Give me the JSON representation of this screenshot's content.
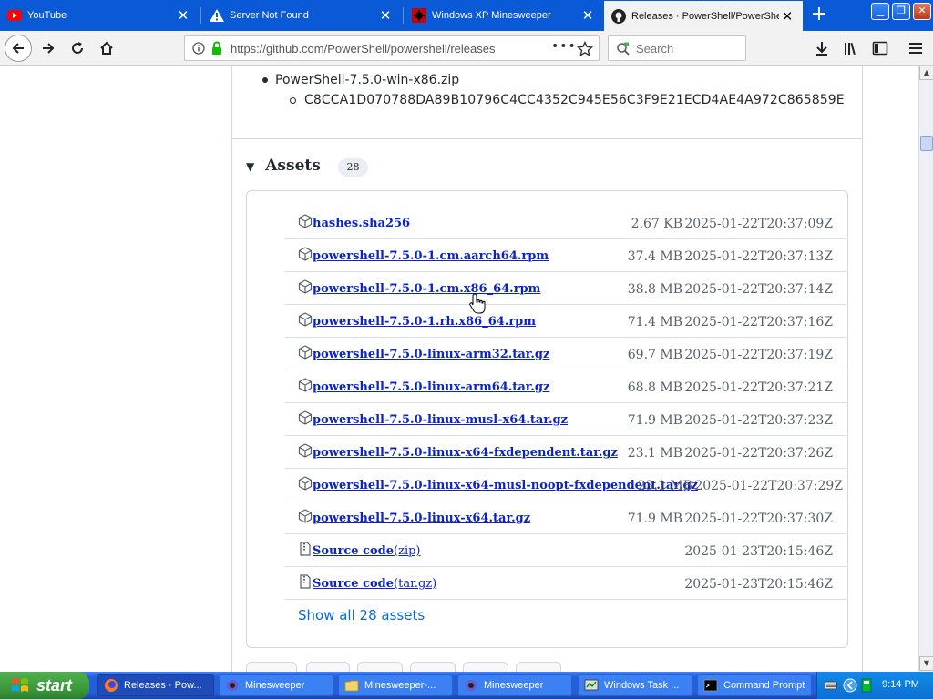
{
  "tabs": [
    {
      "label": "YouTube",
      "icon": "youtube-icon",
      "active": false
    },
    {
      "label": "Server Not Found",
      "icon": "warning-icon",
      "active": false
    },
    {
      "label": "Windows XP Minesweeper",
      "icon": "mine-icon",
      "active": false
    },
    {
      "label": "Releases · PowerShell/PowerShell",
      "icon": "github-icon",
      "active": true
    }
  ],
  "nav": {
    "url": "https://github.com/PowerShell/powershell/releases",
    "search_placeholder": "Search",
    "page_actions": "•••"
  },
  "page": {
    "bullet_file": "PowerShell-7.5.0-win-x86.zip",
    "bullet_hash": "C8CCA1D070788DA89B10796C4CC4352C945E56C3F9E21ECD4AE4A972C865859E",
    "assets_title": "Assets",
    "assets_count": "28",
    "show_all": "Show all 28 assets"
  },
  "assets": [
    {
      "name": "hashes.sha256",
      "size": "2.67 KB",
      "date": "2025-01-22T20:37:09Z",
      "kind": "package"
    },
    {
      "name": "powershell-7.5.0-1.cm.aarch64.rpm",
      "size": "37.4 MB",
      "date": "2025-01-22T20:37:13Z",
      "kind": "package"
    },
    {
      "name": "powershell-7.5.0-1.cm.x86_64.rpm",
      "size": "38.8 MB",
      "date": "2025-01-22T20:37:14Z",
      "kind": "package"
    },
    {
      "name": "powershell-7.5.0-1.rh.x86_64.rpm",
      "size": "71.4 MB",
      "date": "2025-01-22T20:37:16Z",
      "kind": "package"
    },
    {
      "name": "powershell-7.5.0-linux-arm32.tar.gz",
      "size": "69.7 MB",
      "date": "2025-01-22T20:37:19Z",
      "kind": "package"
    },
    {
      "name": "powershell-7.5.0-linux-arm64.tar.gz",
      "size": "68.8 MB",
      "date": "2025-01-22T20:37:21Z",
      "kind": "package"
    },
    {
      "name": "powershell-7.5.0-linux-musl-x64.tar.gz",
      "size": "71.9 MB",
      "date": "2025-01-22T20:37:23Z",
      "kind": "package"
    },
    {
      "name": "powershell-7.5.0-linux-x64-fxdependent.tar.gz",
      "size": "23.1 MB",
      "date": "2025-01-22T20:37:26Z",
      "kind": "package"
    },
    {
      "name": "powershell-7.5.0-linux-x64-musl-noopt-fxdependent.tar.gz",
      "size": "23.1 MB",
      "date": "2025-01-22T20:37:29Z",
      "kind": "package"
    },
    {
      "name": "powershell-7.5.0-linux-x64.tar.gz",
      "size": "71.9 MB",
      "date": "2025-01-22T20:37:30Z",
      "kind": "package"
    },
    {
      "name": "Source code",
      "suffix": "(zip)",
      "size": "",
      "date": "2025-01-23T20:15:46Z",
      "kind": "source"
    },
    {
      "name": "Source code",
      "suffix": "(tar.gz)",
      "size": "",
      "date": "2025-01-23T20:15:46Z",
      "kind": "source"
    }
  ],
  "taskbar": {
    "start_label": "start",
    "items": [
      {
        "label": "Releases · Pow...",
        "icon": "firefox-icon",
        "active": true
      },
      {
        "label": "Minesweeper",
        "icon": "minesweeper-icon",
        "active": false
      },
      {
        "label": "Minesweeper-...",
        "icon": "folder-icon",
        "active": false
      },
      {
        "label": "Minesweeper",
        "icon": "minesweeper-icon",
        "active": false
      },
      {
        "label": "Windows Task ...",
        "icon": "task-manager-icon",
        "active": false
      },
      {
        "label": "Command Prompt",
        "icon": "cmd-icon",
        "active": false
      }
    ],
    "clock": "9:14 PM"
  },
  "colors": {
    "tabbar": "#0a5ad8",
    "link": "#0b24c9",
    "show_all_link": "#0969da",
    "taskbar": "#245edb",
    "start": "#3c9a3c"
  }
}
